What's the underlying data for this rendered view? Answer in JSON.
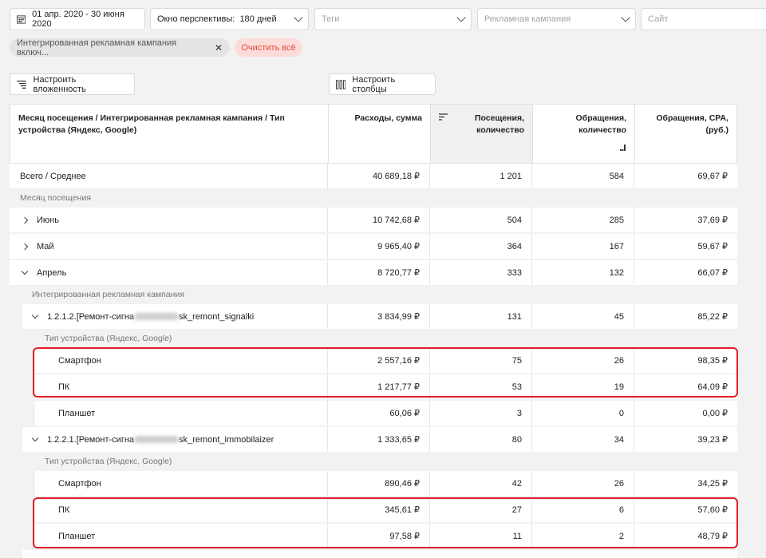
{
  "filters": {
    "date_range": "01 апр. 2020 - 30 июня 2020",
    "window_label": "Окно перспективы:",
    "window_value": "180 дней",
    "tags_placeholder": "Теги",
    "campaign_placeholder": "Рекламная кампания",
    "site_placeholder": "Сайт"
  },
  "chips": {
    "active_filter": "Интегрированная рекламная кампания включ...",
    "clear_all": "Очистить всё"
  },
  "toolbar": {
    "nesting_label": "Настроить вложенность",
    "columns_label": "Настроить столбцы"
  },
  "table": {
    "headers": {
      "dimension": "Месяц посещения / Интегрированная рекламная кампания / Тип устройства (Яндекс, Google)",
      "spend": "Расходы, сумма",
      "visits": "Посещения, количество",
      "conversions": "Обращения, количество",
      "cpa": "Обращения, CPA, (руб.)"
    },
    "total": {
      "label": "Всего / Среднее",
      "spend": "40 689,18 ₽",
      "visits": "1 201",
      "conversions": "584",
      "cpa": "69,67 ₽"
    },
    "group_month": "Месяц посещения",
    "months": [
      {
        "label": "Июнь",
        "spend": "10 742,68 ₽",
        "visits": "504",
        "conversions": "285",
        "cpa": "37,69 ₽"
      },
      {
        "label": "Май",
        "spend": "9 965,40 ₽",
        "visits": "364",
        "conversions": "167",
        "cpa": "59,67 ₽"
      },
      {
        "label": "Апрель",
        "spend": "8 720,77 ₽",
        "visits": "333",
        "conversions": "132",
        "cpa": "66,07 ₽"
      }
    ],
    "group_campaign": "Интегрированная рекламная кампания",
    "group_device": "Тип устройства (Яндекс, Google)",
    "campaigns": [
      {
        "label_start": "1.2.1.2.[Ремонт-сигна",
        "label_end": "sk_remont_signalki",
        "spend": "3 834,99 ₽",
        "visits": "131",
        "conversions": "45",
        "cpa": "85,22 ₽",
        "devices": [
          {
            "label": "Смартфон",
            "spend": "2 557,16 ₽",
            "visits": "75",
            "conversions": "26",
            "cpa": "98,35 ₽"
          },
          {
            "label": "ПК",
            "spend": "1 217,77 ₽",
            "visits": "53",
            "conversions": "19",
            "cpa": "64,09 ₽"
          },
          {
            "label": "Планшет",
            "spend": "60,06 ₽",
            "visits": "3",
            "conversions": "0",
            "cpa": "0,00 ₽"
          }
        ]
      },
      {
        "label_start": "1.2.2.1.[Ремонт-сигна",
        "label_end": "sk_remont_immobilaizer",
        "spend": "1 333,65 ₽",
        "visits": "80",
        "conversions": "34",
        "cpa": "39,23 ₽",
        "devices": [
          {
            "label": "Смартфон",
            "spend": "890,46 ₽",
            "visits": "42",
            "conversions": "26",
            "cpa": "34,25 ₽"
          },
          {
            "label": "ПК",
            "spend": "345,61 ₽",
            "visits": "27",
            "conversions": "6",
            "cpa": "57,60 ₽"
          },
          {
            "label": "Планшет",
            "spend": "97,58 ₽",
            "visits": "11",
            "conversions": "2",
            "cpa": "48,79 ₽"
          }
        ]
      }
    ]
  },
  "colors": {
    "highlight": "#e01e2a",
    "clear_bg": "#fcdcd8",
    "clear_text": "#e5483a"
  }
}
